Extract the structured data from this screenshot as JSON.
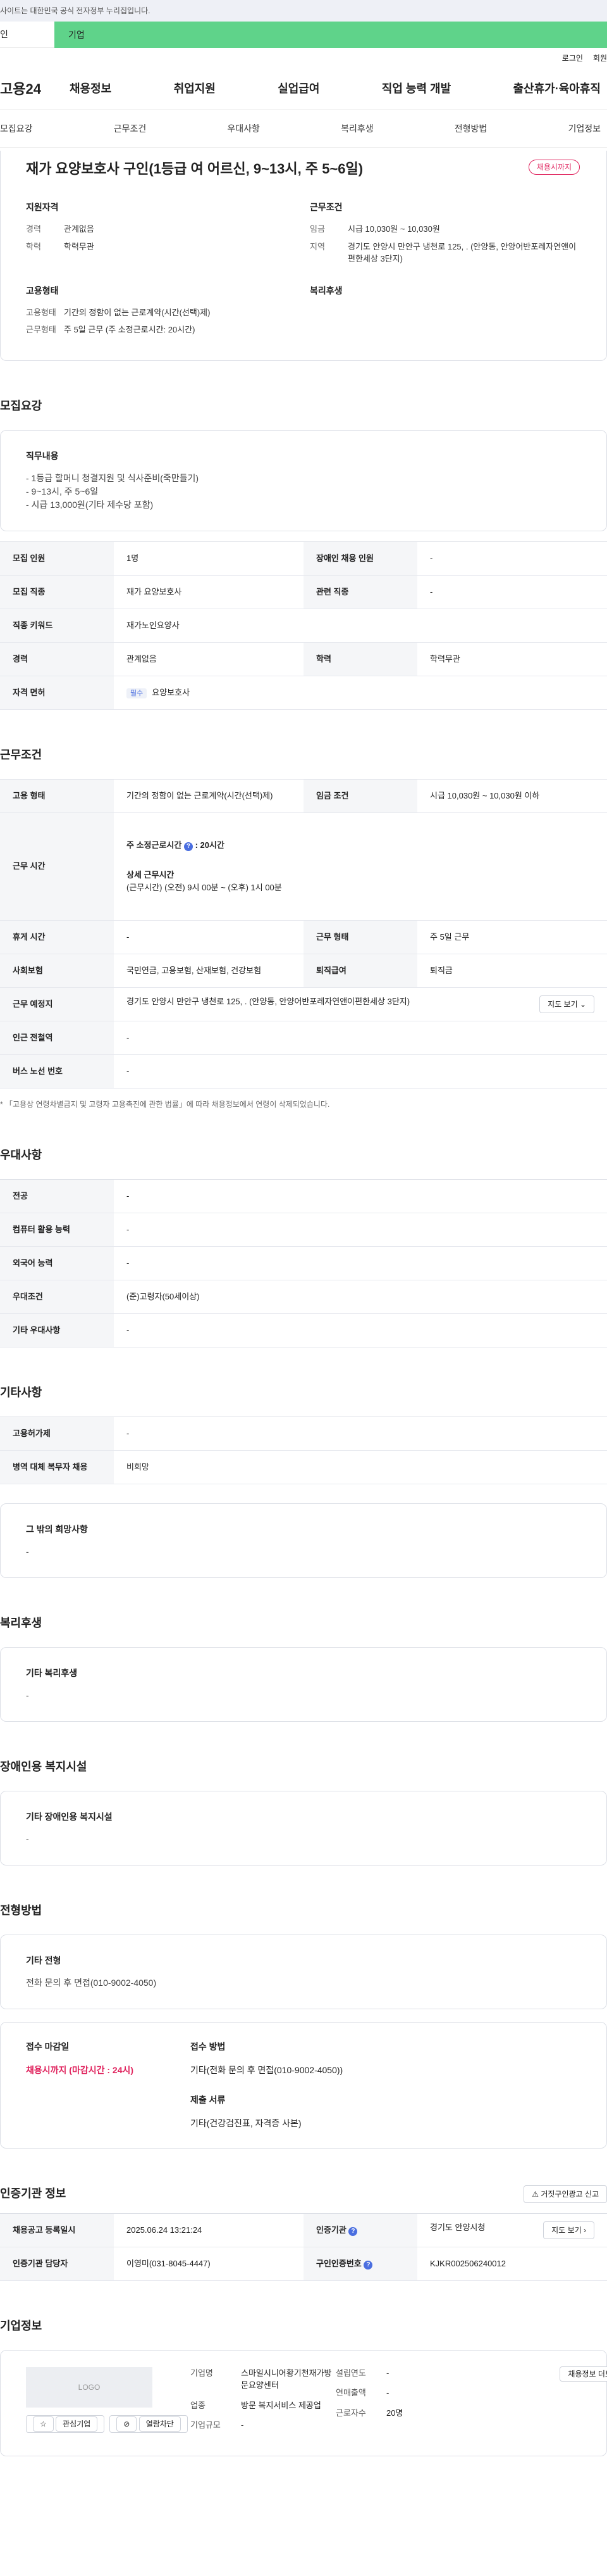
{
  "topbar": {
    "notice": "사이트는 대한민국 공식 전자정부 누리집입니다."
  },
  "svc": {
    "personal": "인",
    "enterprise": "기업"
  },
  "util": {
    "login": "로그인",
    "join": "회원"
  },
  "gnb": {
    "logo": "고용24",
    "menu": [
      "채용정보",
      "취업지원",
      "실업급여",
      "직업 능력 개발",
      "출산휴가·육아휴직"
    ]
  },
  "tabs": [
    "모집요강",
    "근무조건",
    "우대사항",
    "복리후생",
    "전형방법",
    "기업정보"
  ],
  "job": {
    "title": "재가 요양보호사 구인(1등급 여 어르신, 9~13시, 주 5~6일)",
    "badge": "채용시까지",
    "qual_title": "지원자격",
    "career_k": "경력",
    "career_v": "관계없음",
    "edu_k": "학력",
    "edu_v": "학력무관",
    "cond_title": "근무조건",
    "wage_k": "임금",
    "wage_v": "시급 10,030원 ~ 10,030원",
    "loc_k": "지역",
    "loc_v": "경기도 안양시 만안구 냉천로 125, . (안양동, 안양어반포레자연앤이편한세상 3단지)",
    "emp_title": "고용형태",
    "emptype_k": "고용형태",
    "emptype_v": "기간의 정함이 없는 근로계약(시간(선택)제)",
    "worktype_k": "근무형태",
    "worktype_v": "주 5일 근무 (주 소정근로시간: 20시간)",
    "welfare_title": "복리후생"
  },
  "recruit": {
    "title": "모집요강",
    "duty_title": "직무내용",
    "duty_lines": [
      "- 1등급 할머니 청결지원 및 식사준비(죽만들기)",
      "- 9~13시, 주 5~6일",
      "- 시급 13,000원(기타 제수당 포함)"
    ],
    "rows": [
      [
        "모집 인원",
        "1명",
        "장애인 채용 인원",
        "-"
      ],
      [
        "모집 직종",
        "재가 요양보호사",
        "관련 직종",
        "-"
      ]
    ],
    "kw_k": "직종 키워드",
    "kw_v": "재가노인요양사",
    "career_k": "경력",
    "career_v": "관계없음",
    "edu_k": "학력",
    "edu_v": "학력무관",
    "lic_k": "자격 면허",
    "lic_tag": "필수",
    "lic_v": "요양보호사"
  },
  "cond": {
    "title": "근무조건",
    "emp_k": "고용 형태",
    "emp_v": "기간의 정함이 없는 근로계약(시간(선택)제)",
    "wage_k": "임금 조건",
    "wage_v": "시급 10,030원 ~ 10,030원 이하",
    "time_k": "근무 시간",
    "week_label": "주 소정근로시간",
    "week_v": ": 20시간",
    "detail_label": "상세 근무시간",
    "detail_v": "(근무시간) (오전) 9시 00분 ~ (오후) 1시 00분",
    "rest_k": "휴게 시간",
    "rest_v": "-",
    "form_k": "근무 형태",
    "form_v": "주 5일 근무",
    "ins_k": "사회보험",
    "ins_v": "국민연금, 고용보험, 산재보험, 건강보험",
    "sev_k": "퇴직급여",
    "sev_v": "퇴직금",
    "place_k": "근무 예정지",
    "place_v": "경기도 안양시 만안구 냉천로 125, . (안양동, 안양어반포레자연앤이편한세상 3단지)",
    "map_btn": "지도 보기",
    "sub_k": "인근 전철역",
    "sub_v": "-",
    "bus_k": "버스 노선 번호",
    "bus_v": "-",
    "note": "* 「고용상 연령차별금지 및 고령자 고용촉진에 관한 법률」에 따라 채용정보에서 연령이 삭제되었습니다."
  },
  "pref": {
    "title": "우대사항",
    "rows": [
      [
        "전공",
        "-"
      ],
      [
        "컴퓨터 활용 능력",
        "-"
      ],
      [
        "외국어 능력",
        "-"
      ],
      [
        "우대조건",
        "(준)고령자(50세이상)"
      ],
      [
        "기타 우대사항",
        "-"
      ]
    ]
  },
  "etc": {
    "title": "기타사항",
    "rows": [
      [
        "고용허가제",
        "-"
      ],
      [
        "병역 대체 복무자 채용",
        "비희망"
      ]
    ],
    "hope_title": "그 밖의 희망사항",
    "hope_v": "-"
  },
  "welfare": {
    "title": "복리후생",
    "sub": "기타 복리후생",
    "v": "-"
  },
  "disab": {
    "title": "장애인용 복지시설",
    "sub": "기타 장애인용 복지시설",
    "v": "-"
  },
  "select": {
    "title": "전형방법",
    "etc_sub": "기타 전형",
    "etc_v": "전화 문의 후 면접(010-9002-4050)",
    "deadline_k": "접수 마감일",
    "deadline_v": "채용시까지 (마감시간 : 24시)",
    "method_k": "접수 방법",
    "method_v": "기타(전화 문의 후 면접(010-9002-4050))",
    "doc_k": "제출 서류",
    "doc_v": "기타(건강검진표, 자격증 사본)"
  },
  "inst": {
    "title": "인증기관 정보",
    "report_btn": "거짓구인광고 신고",
    "reg_k": "채용공고 등록일시",
    "reg_v": "2025.06.24 13:21:24",
    "org_k": "인증기관",
    "org_v": "경기도 안양시청",
    "map_btn": "지도 보기",
    "mgr_k": "인증기관 담당자",
    "mgr_v": "이영미(031-8045-4447)",
    "num_k": "구인인증번호",
    "num_v": "KJKR002506240012"
  },
  "company": {
    "title": "기업정보",
    "logo": "LOGO",
    "fav_btn": "관심기업",
    "block_btn": "열람차단",
    "name_k": "기업명",
    "name_v": "스마일시니어황기천재가방문요양센터",
    "ind_k": "업종",
    "ind_v": "방문 복지서비스 제공업",
    "size_k": "기업규모",
    "size_v": "-",
    "year_k": "설립연도",
    "year_v": "-",
    "sales_k": "연매출액",
    "sales_v": "-",
    "emp_k": "근로자수",
    "emp_v": "20명",
    "more_btn": "채용정보 더보"
  }
}
